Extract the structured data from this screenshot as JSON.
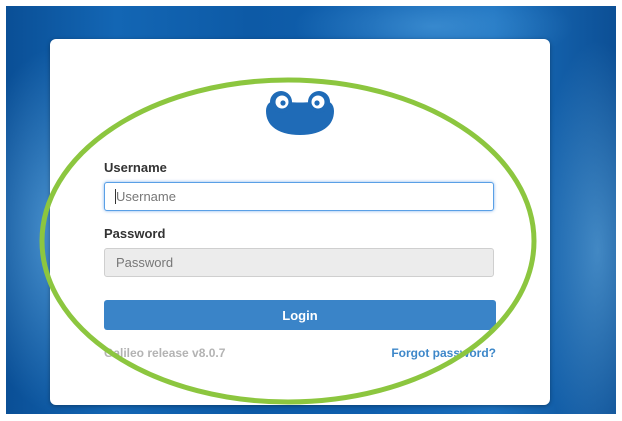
{
  "login_form": {
    "logo_icon": "frog-logo-icon",
    "username_label": "Username",
    "username_placeholder": "Username",
    "username_value": "",
    "password_label": "Password",
    "password_placeholder": "Password",
    "password_value": "",
    "login_button_label": "Login",
    "release_text": "Galileo release v8.0.7",
    "forgot_password_link": "Forgot password?"
  },
  "colors": {
    "accent": "#3a84c8",
    "background": "#0d5aa6",
    "annotation_ellipse": "#8cc63f"
  }
}
